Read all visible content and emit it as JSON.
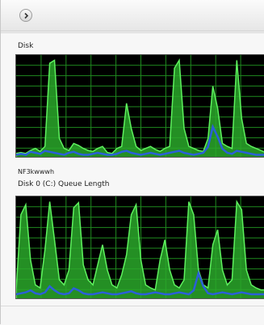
{
  "toolbar": {
    "nav_icon": "forward-arrow-icon"
  },
  "disk_section": {
    "title": "Disk"
  },
  "queue_section": {
    "sub_value": "NF3kwwwh",
    "title": "Disk 0 (C:) Queue Length"
  },
  "colors": {
    "graph_bg": "#000000",
    "grid": "#1f8a1f",
    "fill": "#2aa82a",
    "fill_edge": "#5ef05e",
    "line": "#2b5fd9"
  },
  "graphs": {
    "disk": {
      "activity": [
        0.05,
        0.06,
        0.05,
        0.08,
        0.1,
        0.07,
        0.12,
        0.95,
        0.98,
        0.2,
        0.1,
        0.08,
        0.15,
        0.13,
        0.1,
        0.08,
        0.07,
        0.1,
        0.12,
        0.06,
        0.05,
        0.1,
        0.12,
        0.55,
        0.3,
        0.12,
        0.08,
        0.1,
        0.12,
        0.09,
        0.07,
        0.1,
        0.12,
        0.9,
        0.98,
        0.3,
        0.12,
        0.1,
        0.08,
        0.07,
        0.2,
        0.72,
        0.5,
        0.15,
        0.12,
        0.1,
        0.98,
        0.4,
        0.15,
        0.12,
        0.1,
        0.08,
        0.06
      ],
      "secondary": [
        0.02,
        0.03,
        0.02,
        0.05,
        0.04,
        0.03,
        0.06,
        0.05,
        0.04,
        0.03,
        0.02,
        0.04,
        0.05,
        0.03,
        0.02,
        0.02,
        0.03,
        0.04,
        0.03,
        0.02,
        0.02,
        0.03,
        0.05,
        0.06,
        0.04,
        0.03,
        0.02,
        0.03,
        0.04,
        0.03,
        0.02,
        0.03,
        0.04,
        0.05,
        0.06,
        0.04,
        0.03,
        0.02,
        0.03,
        0.04,
        0.1,
        0.3,
        0.2,
        0.08,
        0.04,
        0.03,
        0.06,
        0.05,
        0.04,
        0.03,
        0.02,
        0.02,
        0.02
      ]
    },
    "queue": {
      "activity": [
        0.1,
        0.85,
        0.95,
        0.4,
        0.15,
        0.12,
        0.5,
        0.98,
        0.6,
        0.2,
        0.15,
        0.3,
        0.92,
        0.97,
        0.35,
        0.2,
        0.15,
        0.35,
        0.55,
        0.3,
        0.15,
        0.12,
        0.25,
        0.45,
        0.85,
        0.95,
        0.4,
        0.15,
        0.12,
        0.1,
        0.4,
        0.6,
        0.3,
        0.15,
        0.12,
        0.2,
        0.98,
        0.85,
        0.3,
        0.15,
        0.12,
        0.55,
        0.7,
        0.3,
        0.15,
        0.2,
        0.98,
        0.9,
        0.3,
        0.15,
        0.12,
        0.1,
        0.1
      ],
      "secondary": [
        0.04,
        0.05,
        0.06,
        0.08,
        0.05,
        0.04,
        0.06,
        0.12,
        0.08,
        0.05,
        0.04,
        0.05,
        0.1,
        0.08,
        0.05,
        0.04,
        0.04,
        0.05,
        0.06,
        0.05,
        0.04,
        0.04,
        0.05,
        0.06,
        0.07,
        0.05,
        0.04,
        0.04,
        0.05,
        0.06,
        0.05,
        0.04,
        0.04,
        0.05,
        0.06,
        0.05,
        0.04,
        0.08,
        0.25,
        0.12,
        0.05,
        0.04,
        0.05,
        0.06,
        0.05,
        0.04,
        0.05,
        0.06,
        0.05,
        0.04,
        0.04,
        0.04,
        0.04
      ]
    }
  }
}
